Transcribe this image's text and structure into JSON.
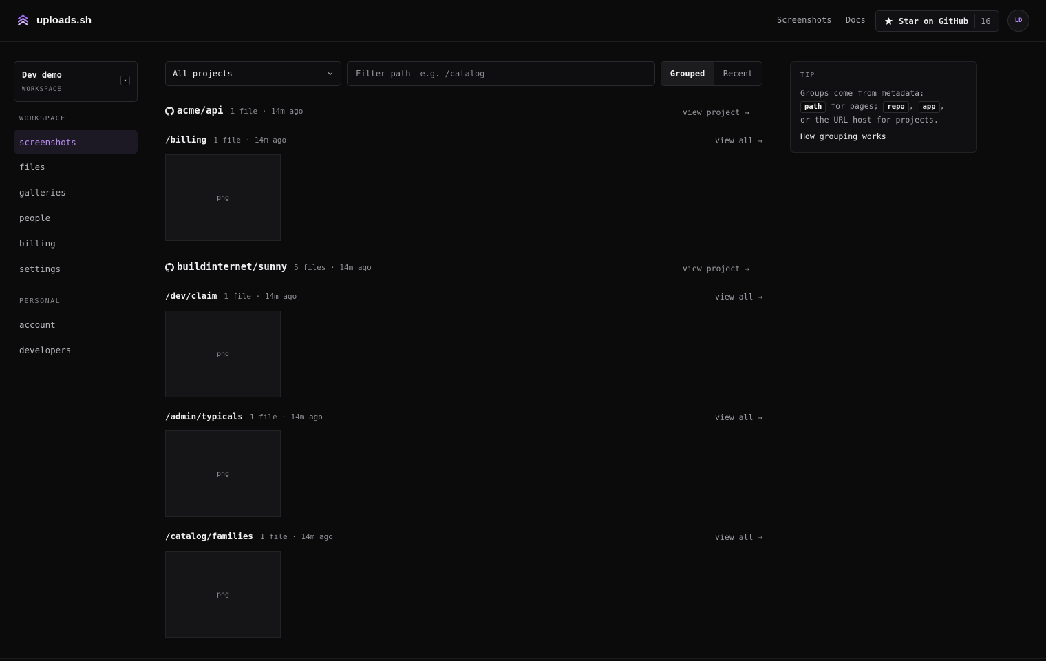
{
  "app": {
    "name": "uploads.sh"
  },
  "topnav": {
    "links": [
      "Screenshots",
      "Docs"
    ],
    "github": {
      "label": "Star on GitHub",
      "count": "16"
    },
    "avatar_initials": "LD"
  },
  "workspace": {
    "name": "Dev demo",
    "type": "WORKSPACE",
    "caret": "▾"
  },
  "sidebar": {
    "section_workspace": "WORKSPACE",
    "workspace_items": [
      "screenshots",
      "files",
      "galleries",
      "people",
      "billing",
      "settings"
    ],
    "active_item": "screenshots",
    "section_personal": "PERSONAL",
    "personal_items": [
      "account",
      "developers"
    ]
  },
  "toolbar": {
    "project_select": "All projects",
    "filter_label": "Filter path",
    "filter_placeholder": "e.g. /catalog",
    "view_modes": [
      "Grouped",
      "Recent"
    ],
    "active_mode": "Grouped"
  },
  "projects": [
    {
      "name": "acme/api",
      "meta": "1 file · 14m ago",
      "link": "view project →",
      "paths": [
        {
          "path": "/billing",
          "meta": "1 file · 14m ago",
          "link": "view all →",
          "thumbs": [
            "png"
          ]
        }
      ]
    },
    {
      "name": "buildinternet/sunny",
      "meta": "5 files · 14m ago",
      "link": "view project →",
      "paths": [
        {
          "path": "/dev/claim",
          "meta": "1 file · 14m ago",
          "link": "view all →",
          "thumbs": [
            "png"
          ]
        },
        {
          "path": "/admin/typicals",
          "meta": "1 file · 14m ago",
          "link": "view all →",
          "thumbs": [
            "png"
          ]
        },
        {
          "path": "/catalog/families",
          "meta": "1 file · 14m ago",
          "link": "view all →",
          "thumbs": [
            "png"
          ]
        }
      ]
    }
  ],
  "tip": {
    "title": "TIP",
    "line1": "Groups come from metadata:",
    "code_path": "path",
    "text_for_pages": "for pages;",
    "code_repo": "repo",
    "comma1": ",",
    "code_app": "app",
    "comma2": ",",
    "line3": "or the URL host for projects.",
    "link": "How grouping works"
  },
  "colors": {
    "accent": "#b98cf5",
    "background": "#0b0b0c",
    "active_bg": "#1d1924"
  }
}
